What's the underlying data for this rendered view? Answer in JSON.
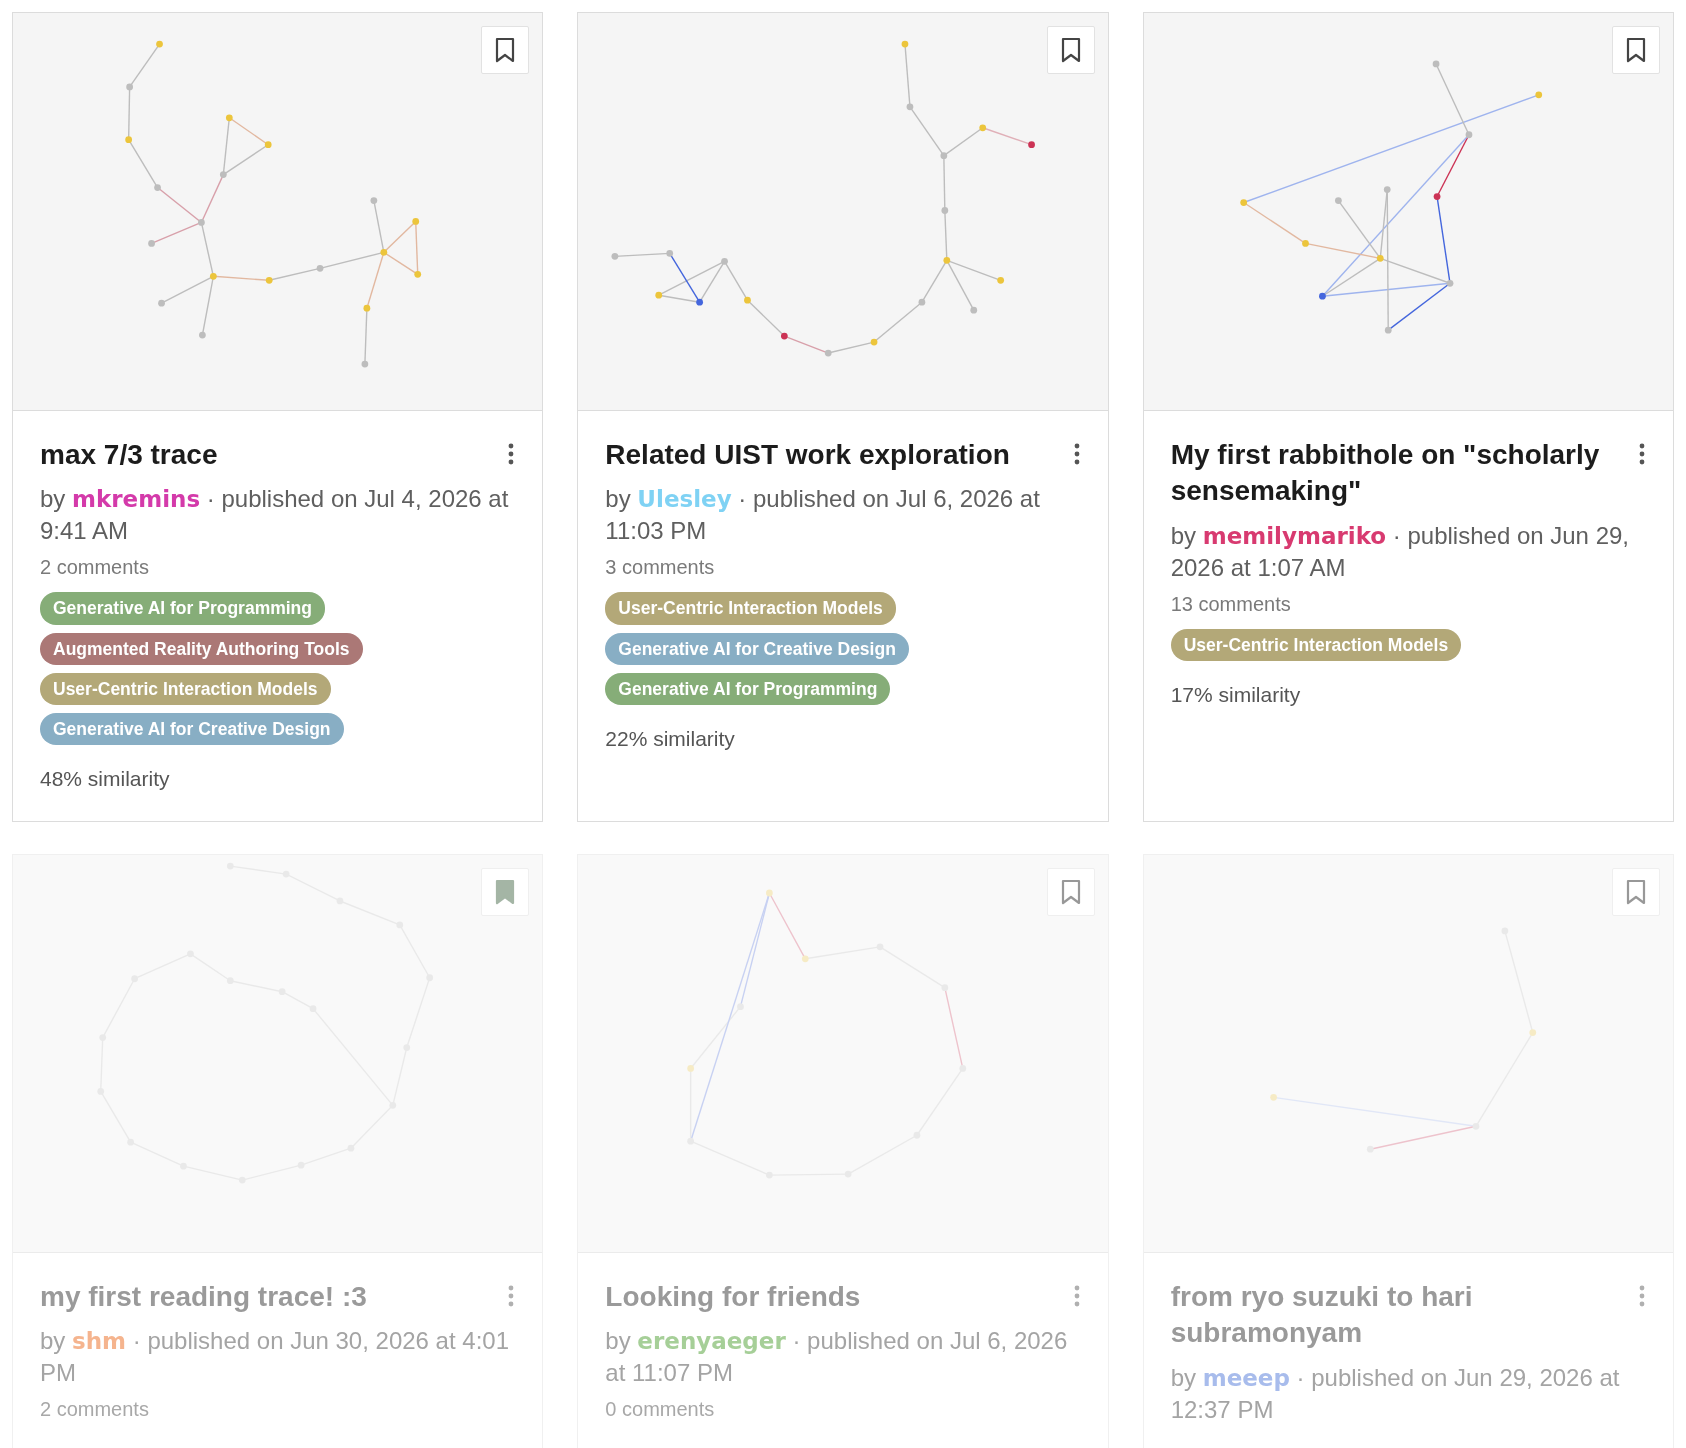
{
  "cards": [
    {
      "title": "max 7/3 trace",
      "bookmarked": false,
      "faded": false,
      "by": "by",
      "author": {
        "name": "mkremins",
        "color": "#d43aaa"
      },
      "published": "· published on Jul 4, 2026 at 9:41 AM",
      "comments": "2 comments",
      "tags": [
        {
          "label": "Generative AI for Programming",
          "color": "#86ad78"
        },
        {
          "label": "Augmented Reality Authoring Tools",
          "color": "#ab7876"
        },
        {
          "label": "User-Centric Interaction Models",
          "color": "#b3a878"
        },
        {
          "label": "Generative AI for Creative Design",
          "color": "#88aec4"
        }
      ],
      "similarity": "48% similarity"
    },
    {
      "title": "Related UIST work exploration",
      "bookmarked": false,
      "faded": false,
      "by": "by",
      "author": {
        "name": "Ulesley",
        "color": "#7fd2f4"
      },
      "published": "· published on Jul 6, 2026 at 11:03 PM",
      "comments": "3 comments",
      "tags": [
        {
          "label": "User-Centric Interaction Models",
          "color": "#b3a878"
        },
        {
          "label": "Generative AI for Creative Design",
          "color": "#88aec4"
        },
        {
          "label": "Generative AI for Programming",
          "color": "#86ad78"
        }
      ],
      "similarity": "22% similarity"
    },
    {
      "title": "My first rabbithole on \"scholarly sensemaking\"",
      "bookmarked": false,
      "faded": false,
      "by": "by",
      "author": {
        "name": "memilymariko",
        "color": "#d83a70"
      },
      "published": "· published on Jun 29, 2026 at 1:07 AM",
      "comments": "13 comments",
      "tags": [
        {
          "label": "User-Centric Interaction Models",
          "color": "#b3a878"
        }
      ],
      "similarity": "17% similarity"
    },
    {
      "title": "my first reading trace! :3",
      "bookmarked": true,
      "faded": true,
      "by": "by",
      "author": {
        "name": "shm",
        "color": "#f5b48e"
      },
      "published": "· published on Jun 30, 2026 at 4:01 PM",
      "comments": "2 comments"
    },
    {
      "title": "Looking for friends",
      "bookmarked": false,
      "faded": true,
      "by": "by",
      "author": {
        "name": "erenyaeger",
        "color": "#a6cf98"
      },
      "published": "· published on Jul 6, 2026 at 11:07 PM",
      "comments": "0 comments"
    },
    {
      "title": "from ryo suzuki to hari subramonyam",
      "bookmarked": false,
      "faded": true,
      "by": "by",
      "author": {
        "name": "meeep",
        "color": "#a8bcec"
      },
      "published": "· published on Jun 29, 2026 at 12:37 PM"
    }
  ]
}
